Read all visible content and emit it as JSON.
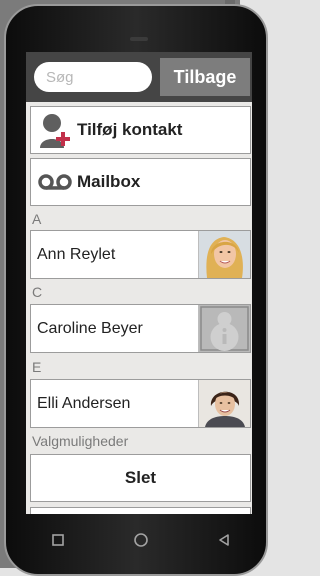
{
  "search": {
    "placeholder": "Søg"
  },
  "header": {
    "back_label": "Tilbage"
  },
  "actions": {
    "add_contact_label": "Tilføj kontakt",
    "mailbox_label": "Mailbox"
  },
  "sections": {
    "a": "A",
    "c": "C",
    "e": "E",
    "options": "Valgmuligheder"
  },
  "contacts": [
    {
      "name": "Ann Reylet",
      "photo": "woman-photo-blonde"
    },
    {
      "name": "Caroline Beyer",
      "photo": "placeholder-info-icon"
    },
    {
      "name": "Elli Andersen",
      "photo": "woman-photo-dark-hair"
    }
  ],
  "options": {
    "delete_label": "Slet"
  },
  "colors": {
    "topbar": "#454545",
    "back_button": "#7d7d7d",
    "add_plus": "#c2304a"
  },
  "navbar": {
    "icons": [
      "square-recents-icon",
      "circle-home-icon",
      "triangle-back-icon"
    ]
  }
}
